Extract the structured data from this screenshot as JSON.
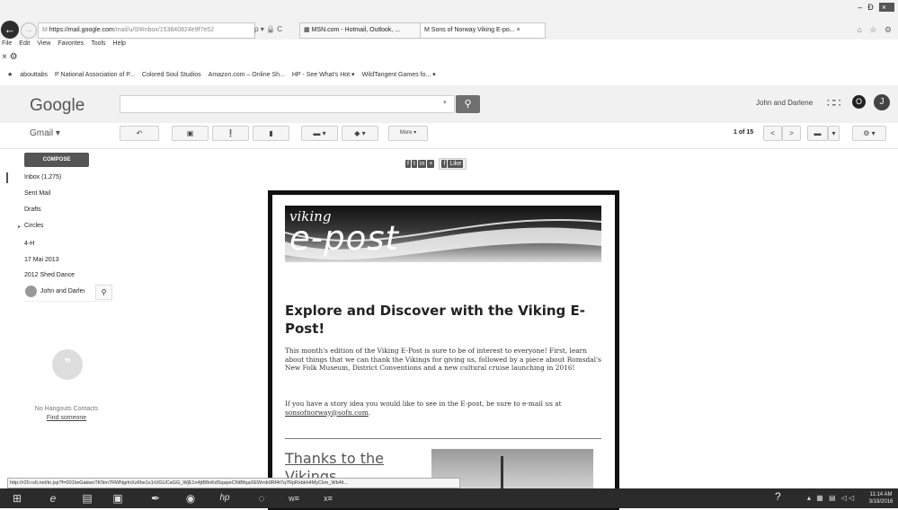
{
  "browser": {
    "address_host": "https://mail.google.com",
    "address_rest": "/mail/u/0/#inbox/153840824e9f7e52",
    "address_tools": "ρ ▾ 🔒 C",
    "tabs": [
      {
        "label": "MSN.com - Hotmail, Outlook, ..."
      },
      {
        "label": "Sons of Norway Viking E-po... ×"
      }
    ],
    "window_controls": [
      "–",
      "Ɖ",
      "×"
    ],
    "right_glyphs": "⌂ ☆ ⚙",
    "menu": [
      "File",
      "Edit",
      "View",
      "Favorites",
      "Tools",
      "Help"
    ],
    "favorites": [
      "abouttabs",
      "P National Association of P...",
      "Colored Soul Studios",
      "Amazon.com – Online Sh...",
      "HP - See What's Hot ▾",
      "WildTangent Games fo... ▾"
    ]
  },
  "gmail": {
    "logo": "Google",
    "search_placeholder": "",
    "user_name": "John and Darlene",
    "notif_letter": "O",
    "avatar_letter": "J",
    "menu_label": "Gmail ▾",
    "toolbar": {
      "reply": "↶",
      "archive": "▣",
      "spam": "❗",
      "delete": "▮",
      "move": "▬ ▾",
      "labels": "◆ ▾",
      "more": "More ▾",
      "page_count": "1 of 15",
      "prev": "<",
      "next": ">",
      "input_tools": "▬",
      "input_dd": "▾",
      "settings": "⚙ ▾"
    },
    "compose": "COMPOSE",
    "nav": [
      "Inbox (1,275)",
      "Sent Mail",
      "Drafts",
      "Circles",
      "4-H",
      "17 Mai 2013",
      "2012 Shed Dance"
    ],
    "hangout_name": "John and Darleı",
    "no_hangouts": "No Hangouts Contacts",
    "find_someone": "Find someone"
  },
  "email": {
    "share": [
      "f",
      "t",
      "in",
      "+"
    ],
    "like": "Like",
    "banner_viking": "viking",
    "banner_epost": "e-post",
    "headline": "Explore and Discover with the Viking E-Post!",
    "para1": "This month's edition of the Viking E-Post is sure to be of interest to everyone! First, learn about things that we can thank the Vikings for giving us, followed by a piece about Romsdal's New Folk Museum, District Conventions and a new cultural cruise launching in 2016!",
    "para2_pre": "If you have a story idea you would like to see in the E-post, be sure to e-mail us at ",
    "para2_link": "sonsofnorway@sofn.com",
    "para2_post": ".",
    "thanks_heading": "Thanks to the Vikings"
  },
  "status_url": "http://r20.rs6.net/tn.jsp?f=001IwGakwoTKNm7RWNgrlnXz6he1s1rUGUCaGG_WjE1n4jtB8nKdSqapeCNtBfqaXEWmb0Rf4t7q7RpRxbkh4MyCkm_Wb4lt...",
  "taskbar": {
    "icons": [
      "⊞",
      "e",
      "▤",
      "▣",
      "✒",
      "◉",
      "hp",
      "◌",
      "w≡",
      "x≡"
    ],
    "help": "?",
    "tray": "▴ ▦ ▤ ◁◁",
    "time": "11:14 AM",
    "date": "3/19/2016"
  }
}
